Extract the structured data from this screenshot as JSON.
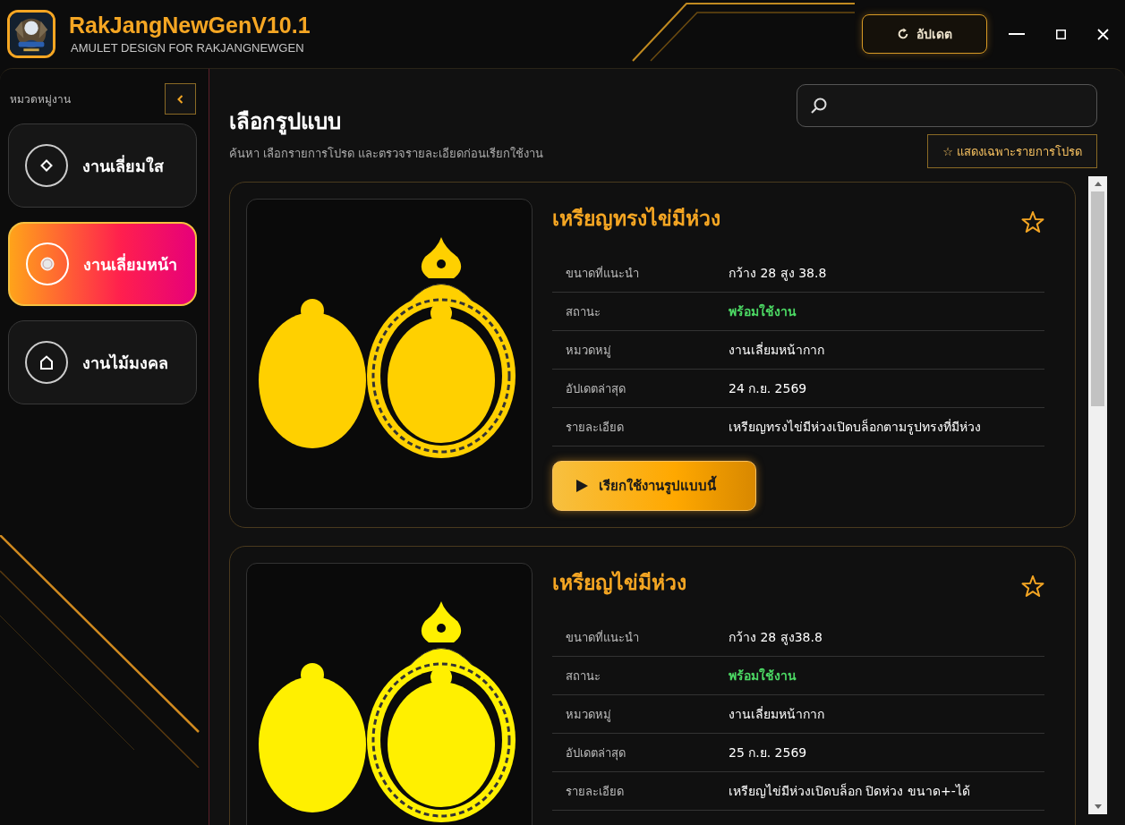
{
  "app": {
    "title": "RakJangNewGenV10.1",
    "subtitle": "AMULET DESIGN FOR RAKJANGNEWGEN",
    "update_button": "อัปเดต"
  },
  "sidebar": {
    "heading": "หมวดหมู่งาน",
    "items": [
      {
        "label": "งานเลี่ยมใส",
        "kind": "diamond",
        "selected": false
      },
      {
        "label": "งานเลี่ยมหน้า",
        "kind": "target",
        "selected": true
      },
      {
        "label": "งานไม้มงคล",
        "kind": "house",
        "selected": false
      }
    ]
  },
  "main": {
    "title": "เลือกรูปแบบ",
    "subtitle": "ค้นหา เลือกรายการโปรด และตรวจรายละเอียดก่อนเรียกใช้งาน",
    "filter_button": "☆ แสดงเฉพาะรายการโปรด"
  },
  "cards": [
    {
      "title": "เหรียญทรงไข่มีห่วง",
      "favorite": false,
      "color": "#ffd000",
      "rows": [
        {
          "label": "ขนาดที่แนะนำ",
          "value": "กว้าง 28 สูง 38.8",
          "kind": "text"
        },
        {
          "label": "สถานะ",
          "value": "พร้อมใช้งาน",
          "kind": "status"
        },
        {
          "label": "หมวดหมู่",
          "value": "งานเลี่ยมหน้ากาก",
          "kind": "text"
        },
        {
          "label": "อัปเดตล่าสุด",
          "value": "24 ก.ย. 2569",
          "kind": "text"
        },
        {
          "label": "รายละเอียด",
          "value": "เหรียญทรงไข่มีห่วงเปิดบล็อกตามรูปทรงที่มีห่วง",
          "kind": "text"
        }
      ],
      "button": "เรียกใช้งานรูปแบบนี้"
    },
    {
      "title": "เหรียญไข่มีห่วง",
      "favorite": false,
      "color": "#fff000",
      "rows": [
        {
          "label": "ขนาดที่แนะนำ",
          "value": "กว้าง 28 สูง38.8",
          "kind": "text"
        },
        {
          "label": "สถานะ",
          "value": "พร้อมใช้งาน",
          "kind": "status"
        },
        {
          "label": "หมวดหมู่",
          "value": "งานเลี่ยมหน้ากาก",
          "kind": "text"
        },
        {
          "label": "อัปเดตล่าสุด",
          "value": "25 ก.ย. 2569",
          "kind": "text"
        },
        {
          "label": "รายละเอียด",
          "value": "เหรียญไข่มีห่วงเปิดบล็อก ปิดห่วง ขนาด+-ได้",
          "kind": "text"
        }
      ]
    }
  ]
}
